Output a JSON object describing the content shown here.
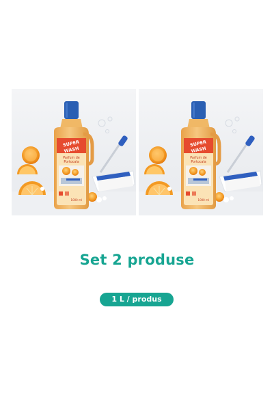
{
  "product": {
    "brand_line1": "SUPER",
    "brand_line2": "WASH",
    "scent_line1": "Parfum de",
    "scent_line2": "Portocala",
    "volume_label": "1000 ml"
  },
  "content": {
    "title": "Set 2 produse",
    "badge": "1 L / produs"
  },
  "colors": {
    "accent": "#17a592",
    "cap": "#2a5fb3",
    "bottle": "#f2b968",
    "orange": "#f08a1c",
    "mop": "#2f5fbf"
  },
  "icons": [
    "orange-slice-icon",
    "mop-icon",
    "bubble-icon"
  ]
}
